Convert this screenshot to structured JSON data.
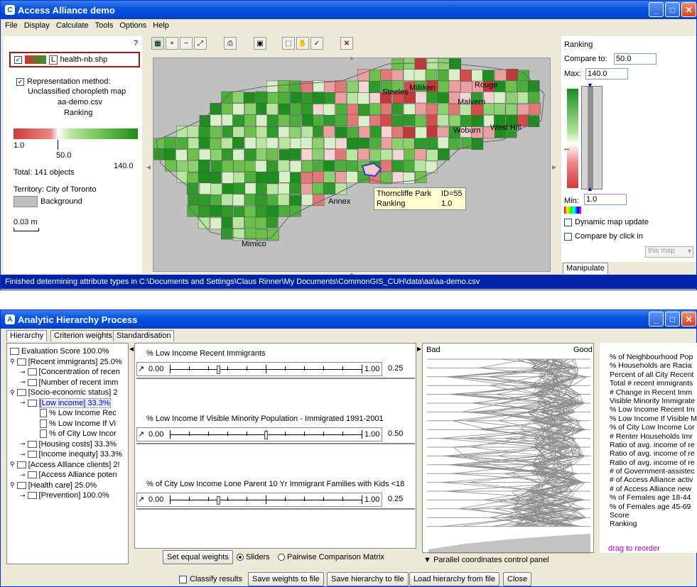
{
  "win1": {
    "title": "Access Alliance demo",
    "menu": [
      "File",
      "Display",
      "Calculate",
      "Tools",
      "Options",
      "Help"
    ]
  },
  "legend": {
    "layer": "health-nb.shp",
    "layer_L": "L",
    "rep_label": "Representation method:",
    "rep_value": "Unclassified choropleth map",
    "file": "aa-demo.csv",
    "attr": "Ranking",
    "min": "1.0",
    "mid": "50.0",
    "max": "140.0",
    "total": "Total: 141 objects",
    "territory": "Territory: City of Toronto",
    "background": "Background",
    "scale": "0.03 m",
    "help": "?"
  },
  "map": {
    "labels": [
      "Steeles",
      "Milliken",
      "Rouge",
      "Malvern",
      "Woburn",
      "West Hill",
      "Annex",
      "Mimico"
    ],
    "tooltip": {
      "name": "Thorncliffe Park",
      "id": "ID=55",
      "attr": "Ranking",
      "val": "1.0"
    }
  },
  "manip": {
    "title": "Ranking",
    "compare_label": "Compare to:",
    "compare_val": "50.0",
    "max_label": "Max:",
    "max_val": "140.0",
    "min_label": "Min:",
    "min_val": "1.0",
    "dyn": "Dynamic map update",
    "cbc": "Compare by click in",
    "select": "this map",
    "tab": "Manipulate"
  },
  "status": "Finished determining attribute types in C:\\Documents and Settings\\Claus Rinner\\My Documents\\CommonGIS_CUH\\data\\aa\\aa-demo.csv",
  "win2": {
    "title": "Analytic Hierarchy Process",
    "tabs": [
      "Hierarchy",
      "Criterion weights",
      "Standardisation"
    ]
  },
  "tree": [
    {
      "text": "Evaluation Score 100.0%",
      "kind": "folder",
      "indent": 0
    },
    {
      "text": "[Recent immigrants] 25.0%",
      "kind": "folder",
      "indent": 0,
      "key": true
    },
    {
      "text": "[Concentration of recen",
      "kind": "folder",
      "indent": 1,
      "key": true
    },
    {
      "text": "[Number of recent imm",
      "kind": "folder",
      "indent": 1,
      "key": true
    },
    {
      "text": "[Socio-economic status] 2",
      "kind": "folder",
      "indent": 0,
      "key": true
    },
    {
      "text": "[Low income] 33.3%",
      "kind": "folder",
      "indent": 1,
      "key": true,
      "sel": true
    },
    {
      "text": "% Low Income Rec",
      "kind": "doc",
      "indent": 3
    },
    {
      "text": "% Low Income If Vi",
      "kind": "doc",
      "indent": 3
    },
    {
      "text": "% of City Low Incor",
      "kind": "doc",
      "indent": 3
    },
    {
      "text": "[Housing costs] 33.3%",
      "kind": "folder",
      "indent": 1,
      "key": true
    },
    {
      "text": "[Income inequity] 33.3%",
      "kind": "folder",
      "indent": 1,
      "key": true
    },
    {
      "text": "[Access Alliance clients] 2!",
      "kind": "folder",
      "indent": 0,
      "key": true
    },
    {
      "text": "[Access Alliance poten",
      "kind": "folder",
      "indent": 1,
      "key": true
    },
    {
      "text": "[Health care] 25.0%",
      "kind": "folder",
      "indent": 0,
      "key": true
    },
    {
      "text": "[Prevention] 100.0%",
      "kind": "folder",
      "indent": 1,
      "key": true
    }
  ],
  "weights": [
    {
      "label": "% Low Income Recent Immigrants",
      "min": "0.00",
      "max": "1.00",
      "val": "0.25",
      "pos": 0.25
    },
    {
      "label": "% Low Income If Visible Minority Population - Immigrated 1991-2001",
      "min": "0.00",
      "max": "1.00",
      "val": "0.50",
      "pos": 0.5
    },
    {
      "label": "% of City Low Income Lone Parent 10 Yr Immigrant Families with Kids <18",
      "min": "0.00",
      "max": "1.00",
      "val": "0.25",
      "pos": 0.25
    }
  ],
  "weights_ctrl": {
    "equal": "Set equal weights",
    "sliders": "Sliders",
    "pairwise": "Pairwise Comparison Matrix"
  },
  "pc": {
    "bad": "Bad",
    "good": "Good",
    "panel": "Parallel coordinates control panel",
    "drag": "drag to reorder"
  },
  "attrs": [
    "% of Neighbourhood Pop",
    "% Households are Racia",
    "Percent of all City Recent",
    "Total # recent immigrants",
    "# Change in Recent Imm",
    "Visible Minority Immigrate",
    "% Low Income Recent Im",
    "% Low Income If Visible M",
    "% of City Low Income Lor",
    "# Renter Households Imr",
    "Ratio of avg. income of re",
    "Ratio of avg. income of re",
    "Ratio of avg. income of re",
    "# of Government-assistec",
    "# of Access Alliance activ",
    "# of Access Alliance new",
    "% of Females age 18-44",
    "% of Females age 45-69",
    "Score",
    "Ranking"
  ],
  "bottom": {
    "classify": "Classify results",
    "save_w": "Save weights to file",
    "save_h": "Save hierarchy to file",
    "load_h": "Load hierarchy from file",
    "close": "Close"
  }
}
